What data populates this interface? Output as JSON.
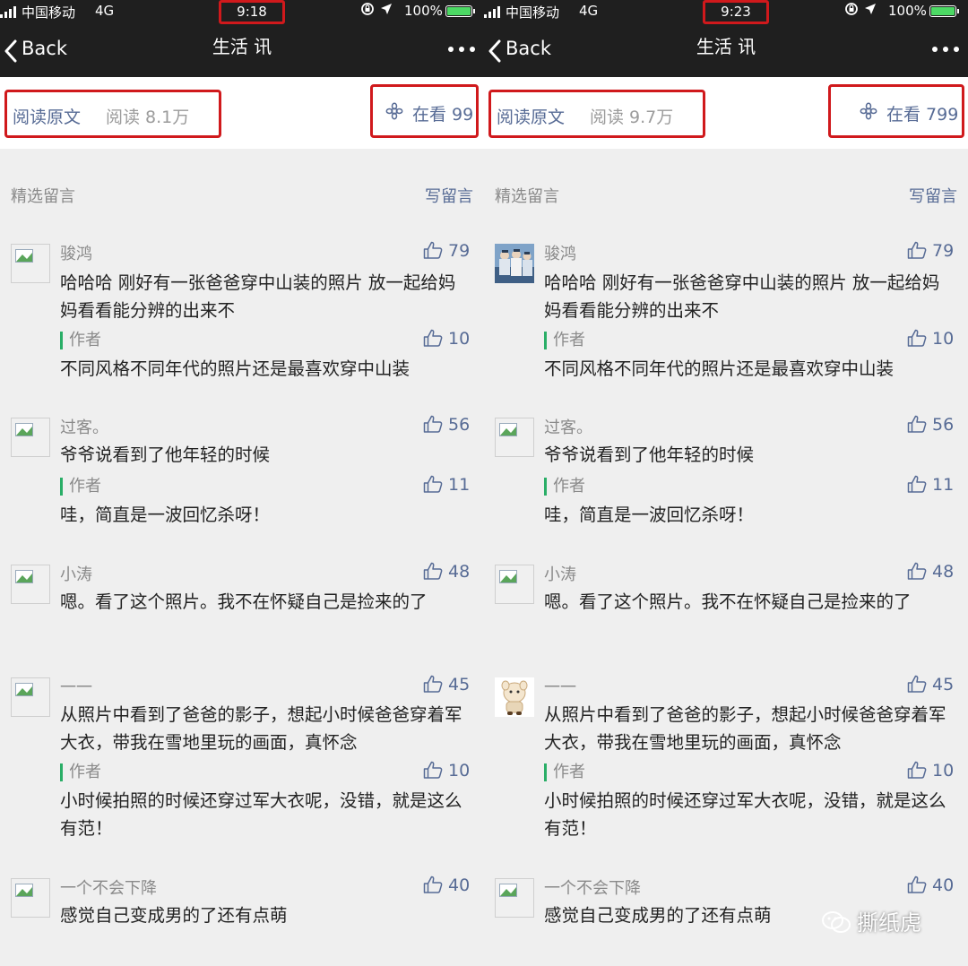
{
  "colors": {
    "accent_blue": "#576b95",
    "highlight_red": "#d0191c",
    "author_green": "#2aae67"
  },
  "panels": [
    {
      "status": {
        "carrier": "中国移动",
        "network": "4G",
        "time": "9:18",
        "battery": "100%"
      },
      "nav": {
        "back": "Back",
        "title": "生活 讯"
      },
      "info": {
        "read_original": "阅读原文",
        "read_count": "阅读 8.1万",
        "watching": "在看 99"
      },
      "comments_header": "精选留言",
      "write_comment": "写留言",
      "comments": [
        {
          "name": "骏鸿",
          "likes": "79",
          "text": "哈哈哈 刚好有一张爸爸穿中山装的照片 放一起给妈妈看看能分辨的出来不",
          "reply": {
            "author": "作者",
            "likes": "10",
            "text": "不同风格不同年代的照片还是最喜欢穿中山装"
          }
        },
        {
          "name": "过客。",
          "likes": "56",
          "text": "爷爷说看到了他年轻的时候",
          "reply": {
            "author": "作者",
            "likes": "11",
            "text": "哇，简直是一波回忆杀呀！"
          }
        },
        {
          "name": "小涛",
          "likes": "48",
          "text": "嗯。看了这个照片。我不在怀疑自己是捡来的了"
        },
        {
          "name": "一一",
          "likes": "45",
          "text": "从照片中看到了爸爸的影子，想起小时候爸爸穿着军大衣，带我在雪地里玩的画面，真怀念",
          "reply": {
            "author": "作者",
            "likes": "10",
            "text": "小时候拍照的时候还穿过军大衣呢，没错，就是这么有范！"
          }
        },
        {
          "name": "一个不会下降",
          "likes": "40",
          "text": "感觉自己变成男的了还有点萌"
        }
      ]
    },
    {
      "status": {
        "carrier": "中国移动",
        "network": "4G",
        "time": "9:23",
        "battery": "100%"
      },
      "nav": {
        "back": "Back",
        "title": "生活 讯"
      },
      "info": {
        "read_original": "阅读原文",
        "read_count": "阅读 9.7万",
        "watching": "在看 799"
      },
      "comments_header": "精选留言",
      "write_comment": "写留言",
      "comments": [
        {
          "name": "骏鸿",
          "likes": "79",
          "text": "哈哈哈 刚好有一张爸爸穿中山装的照片 放一起给妈妈看看能分辨的出来不",
          "reply": {
            "author": "作者",
            "likes": "10",
            "text": "不同风格不同年代的照片还是最喜欢穿中山装"
          }
        },
        {
          "name": "过客。",
          "likes": "56",
          "text": "爷爷说看到了他年轻的时候",
          "reply": {
            "author": "作者",
            "likes": "11",
            "text": "哇，简直是一波回忆杀呀！"
          }
        },
        {
          "name": "小涛",
          "likes": "48",
          "text": "嗯。看了这个照片。我不在怀疑自己是捡来的了"
        },
        {
          "name": "一一",
          "likes": "45",
          "text": "从照片中看到了爸爸的影子，想起小时候爸爸穿着军大衣，带我在雪地里玩的画面，真怀念",
          "reply": {
            "author": "作者",
            "likes": "10",
            "text": "小时候拍照的时候还穿过军大衣呢，没错，就是这么有范！"
          }
        },
        {
          "name": "一个不会下降",
          "likes": "40",
          "text": "感觉自己变成男的了还有点萌"
        }
      ]
    }
  ],
  "watermark": "撕纸虎"
}
